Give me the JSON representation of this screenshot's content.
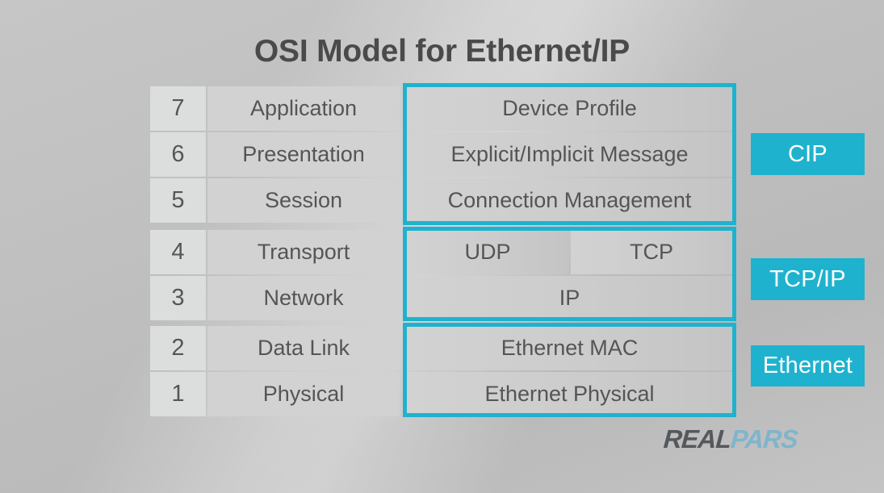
{
  "title": "OSI Model for Ethernet/IP",
  "colors": {
    "accent_cyan": "#1fb2ce",
    "text_gray": "#555555",
    "title_gray": "#4a4a4a",
    "cell_gray": "#d2d2d2",
    "number_cell_gray": "#dcdddd",
    "background_gray": "#c2c2c2",
    "logo_real": "#55595c",
    "logo_pars": "#7fb5cc"
  },
  "layers": [
    {
      "number": "7",
      "name": "Application",
      "protocol": "Device Profile"
    },
    {
      "number": "6",
      "name": "Presentation",
      "protocol": "Explicit/Implicit Message"
    },
    {
      "number": "5",
      "name": "Session",
      "protocol": "Connection Management"
    },
    {
      "number": "4",
      "name": "Transport",
      "protocol_left": "UDP",
      "protocol_right": "TCP"
    },
    {
      "number": "3",
      "name": "Network",
      "protocol": "IP"
    },
    {
      "number": "2",
      "name": "Data Link",
      "protocol": "Ethernet MAC"
    },
    {
      "number": "1",
      "name": "Physical",
      "protocol": "Ethernet Physical"
    }
  ],
  "groups": [
    {
      "id": "cip",
      "label": "CIP",
      "layers": [
        "7",
        "6",
        "5"
      ]
    },
    {
      "id": "tcpip",
      "label": "TCP/IP",
      "layers": [
        "4",
        "3"
      ]
    },
    {
      "id": "ethernet",
      "label": "Ethernet",
      "layers": [
        "2",
        "1"
      ]
    }
  ],
  "logo": {
    "part1": "REAL",
    "part2": "PARS"
  }
}
